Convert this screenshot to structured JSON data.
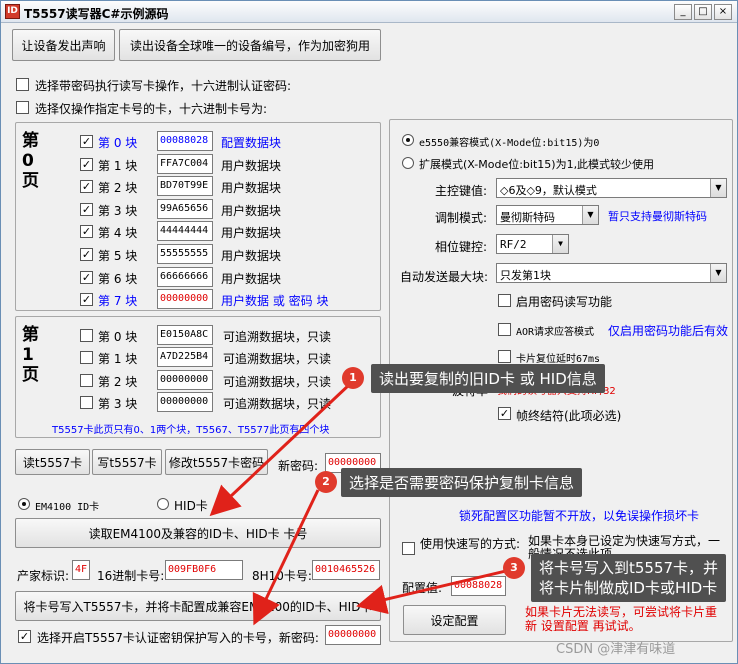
{
  "window": {
    "title": "T5557读写器C#示例源码",
    "icon_text": "ID",
    "min": "_",
    "max": "□",
    "close": "×"
  },
  "top": {
    "beep_btn": "让设备发出声响",
    "uid_btn": "读出设备全球唯一的设备编号，作为加密狗用"
  },
  "options": {
    "pwd_op": {
      "checked": false,
      "label": "选择带密码执行读写卡操作，十六进制认证密码:"
    },
    "card_no": {
      "checked": false,
      "label": "选择仅操作指定卡号的卡，十六进制卡号为:"
    }
  },
  "page0": {
    "title": "第0页",
    "rows": [
      {
        "label": "第 0 块",
        "value": "00088028",
        "desc": "配置数据块",
        "checked": true,
        "hl": true
      },
      {
        "label": "第 1 块",
        "value": "FFA7C004",
        "desc": "用户数据块",
        "checked": true,
        "hl": false
      },
      {
        "label": "第 2 块",
        "value": "BD70T99E",
        "desc": "用户数据块",
        "checked": true,
        "hl": false
      },
      {
        "label": "第 3 块",
        "value": "99A65656",
        "desc": "用户数据块",
        "checked": true,
        "hl": false
      },
      {
        "label": "第 4 块",
        "value": "44444444",
        "desc": "用户数据块",
        "checked": true,
        "hl": false
      },
      {
        "label": "第 5 块",
        "value": "55555555",
        "desc": "用户数据块",
        "checked": true,
        "hl": false
      },
      {
        "label": "第 6 块",
        "value": "66666666",
        "desc": "用户数据块",
        "checked": true,
        "hl": false
      },
      {
        "label": "第 7 块",
        "value": "00000000",
        "desc": "用户数据 或 密码 块",
        "checked": true,
        "hl": true
      }
    ]
  },
  "page1": {
    "title": "第1页",
    "rows": [
      {
        "label": "第 0 块",
        "value": "E0150A8C",
        "desc": "可追溯数据块，只读",
        "checked": false
      },
      {
        "label": "第 1 块",
        "value": "A7D225B4",
        "desc": "可追溯数据块，只读",
        "checked": false
      },
      {
        "label": "第 2 块",
        "value": "00000000",
        "desc": "可追溯数据块，只读",
        "checked": false
      },
      {
        "label": "第 3 块",
        "value": "00000000",
        "desc": "可追溯数据块，只读",
        "checked": false
      }
    ],
    "note": "T5557卡此页只有0、1两个块，T5567、T5577此页有四个块"
  },
  "actions": {
    "read_btn": "读t5557卡",
    "write_btn": "写t5557卡",
    "chpwd_btn": "修改t5557卡密码",
    "newpwd_label": "新密码:",
    "newpwd_value": "00000000"
  },
  "cardtype": {
    "em_label": "EM4100 ID卡",
    "hid_label": "HID卡",
    "selected": "em"
  },
  "read_em_btn": "读取EM4100及兼容的ID卡、HID卡 卡号",
  "ids": {
    "vendor_label": "产家标识:",
    "vendor_value": "4F",
    "hex_label": "16进制卡号:",
    "hex_value": "009FB0F6",
    "dec_label": "8H10卡号:",
    "dec_value": "0010465526"
  },
  "write_em_btn": "将卡号写入T5557卡，并将卡配置成兼容EM4100的ID卡、HID卡",
  "protect": {
    "checked": true,
    "label": "选择开启T5557卡认证密钥保护写入的卡号，新密码:",
    "value": "00000000"
  },
  "right": {
    "mode1": "e5550兼容模式(X-Mode位:bit15)为0",
    "mode2": "扩展模式(X-Mode位:bit15)为1,此模式较少使用",
    "master_label": "主控键值:",
    "master_value": "◇6及◇9，默认模式",
    "mod_label": "调制模式:",
    "mod_value": "曼彻斯特码",
    "mod_note": "暂只支持曼彻斯特码",
    "phase_label": "相位键控:",
    "phase_value": "RF/2",
    "maxblk_label": "自动发送最大块:",
    "maxblk_value": "只发第1块",
    "pwd_func": "启用密码读写功能",
    "aor_label": "AOR请求应答模式",
    "aor_note": "仅启用密码功能后有效",
    "reset_delay": "卡片复位延时67ms",
    "baud_label": "波特率",
    "baud_note": "我们的读写器只支持RF/32",
    "term": "帧终结符(此项必选)",
    "lock_note": "锁死配置区功能暂不开放，以免误操作损坏卡",
    "quick_label": "使用快速写的方式:",
    "quick_text": "如果卡本身已设定为快速写方式，一般情况不选此项。",
    "cfg_label": "配置值:",
    "cfg_value": "00088028",
    "cfg_btn": "设定配置",
    "cfg_warn": "如果卡片无法读写，可尝试将卡片重新 设置配置 再试试。"
  },
  "callouts": {
    "c1": "读出要复制的旧ID卡 或 HID信息",
    "c2": "选择是否需要密码保护复制卡信息",
    "c3_line1": "将卡号写入到t5557卡，并",
    "c3_line2": "将卡片制做成ID卡或HID卡"
  },
  "watermark": "CSDN @津津有味道",
  "colors": {
    "blue": "#0000ff",
    "red": "#e00000",
    "callout_bg": "#505050",
    "badge": "#e03a2c"
  }
}
